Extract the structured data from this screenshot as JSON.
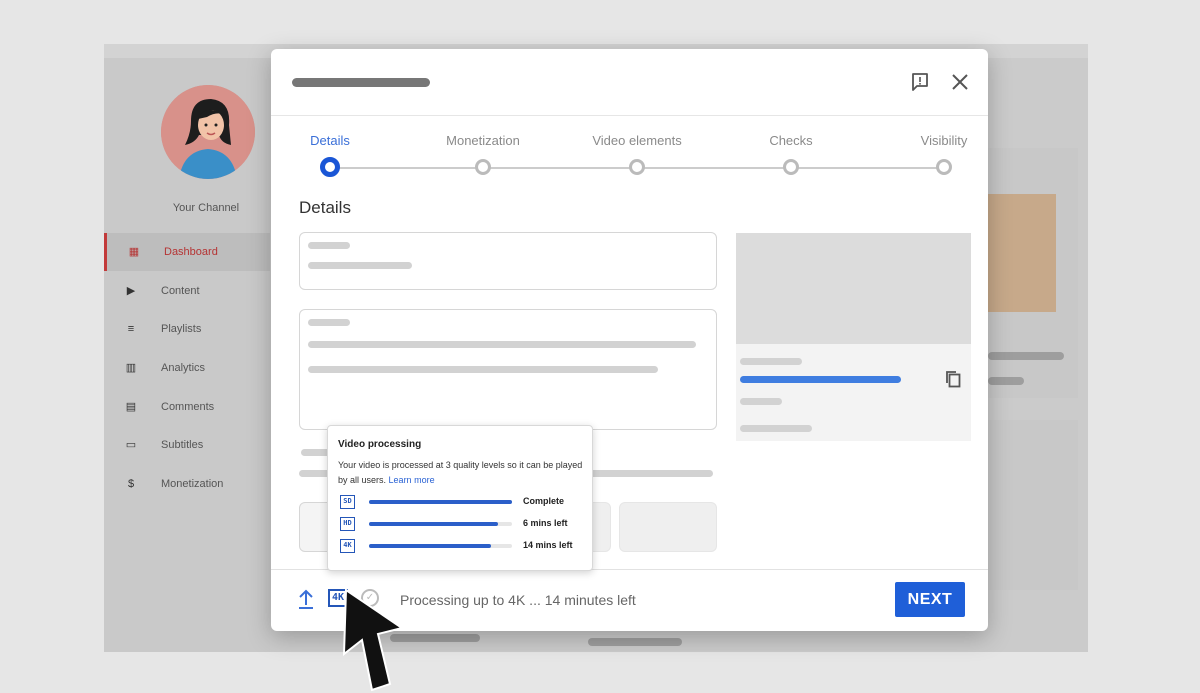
{
  "sidebar": {
    "channel_name": "Your Channel",
    "items": [
      {
        "label": "Dashboard",
        "icon": "dashboard-icon",
        "glyph": "▦",
        "active": true
      },
      {
        "label": "Content",
        "icon": "content-icon",
        "glyph": "▶",
        "active": false
      },
      {
        "label": "Playlists",
        "icon": "playlists-icon",
        "glyph": "≡",
        "active": false
      },
      {
        "label": "Analytics",
        "icon": "analytics-icon",
        "glyph": "▥",
        "active": false
      },
      {
        "label": "Comments",
        "icon": "comments-icon",
        "glyph": "▤",
        "active": false
      },
      {
        "label": "Subtitles",
        "icon": "subtitles-icon",
        "glyph": "▭",
        "active": false
      },
      {
        "label": "Monetization",
        "icon": "monetization-icon",
        "glyph": "$",
        "active": false
      }
    ]
  },
  "dialog": {
    "header_icons": {
      "feedback": "feedback-icon",
      "close": "close-icon"
    },
    "steps": [
      {
        "label": "Details",
        "active": true
      },
      {
        "label": "Monetization",
        "active": false
      },
      {
        "label": "Video elements",
        "active": false
      },
      {
        "label": "Checks",
        "active": false
      },
      {
        "label": "Visibility",
        "active": false
      }
    ],
    "section_title": "Details",
    "footer": {
      "quality_badge": "4K",
      "status_text": "Processing up to 4K ... 14 minutes left",
      "next_label": "NEXT"
    }
  },
  "processing_popup": {
    "title": "Video processing",
    "description": "Your video is processed at 3 quality levels so it can be played by all users.",
    "learn_more": "Learn more",
    "levels": [
      {
        "badge": "SD",
        "progress": 1.0,
        "status": "Complete"
      },
      {
        "badge": "HD",
        "progress": 0.9,
        "status": "6 mins left"
      },
      {
        "badge": "4K",
        "progress": 0.85,
        "status": "14 mins left"
      }
    ]
  },
  "colors": {
    "accent_blue": "#1f5fd8",
    "active_nav_red": "#b53434",
    "background": "#e6e6e6"
  }
}
